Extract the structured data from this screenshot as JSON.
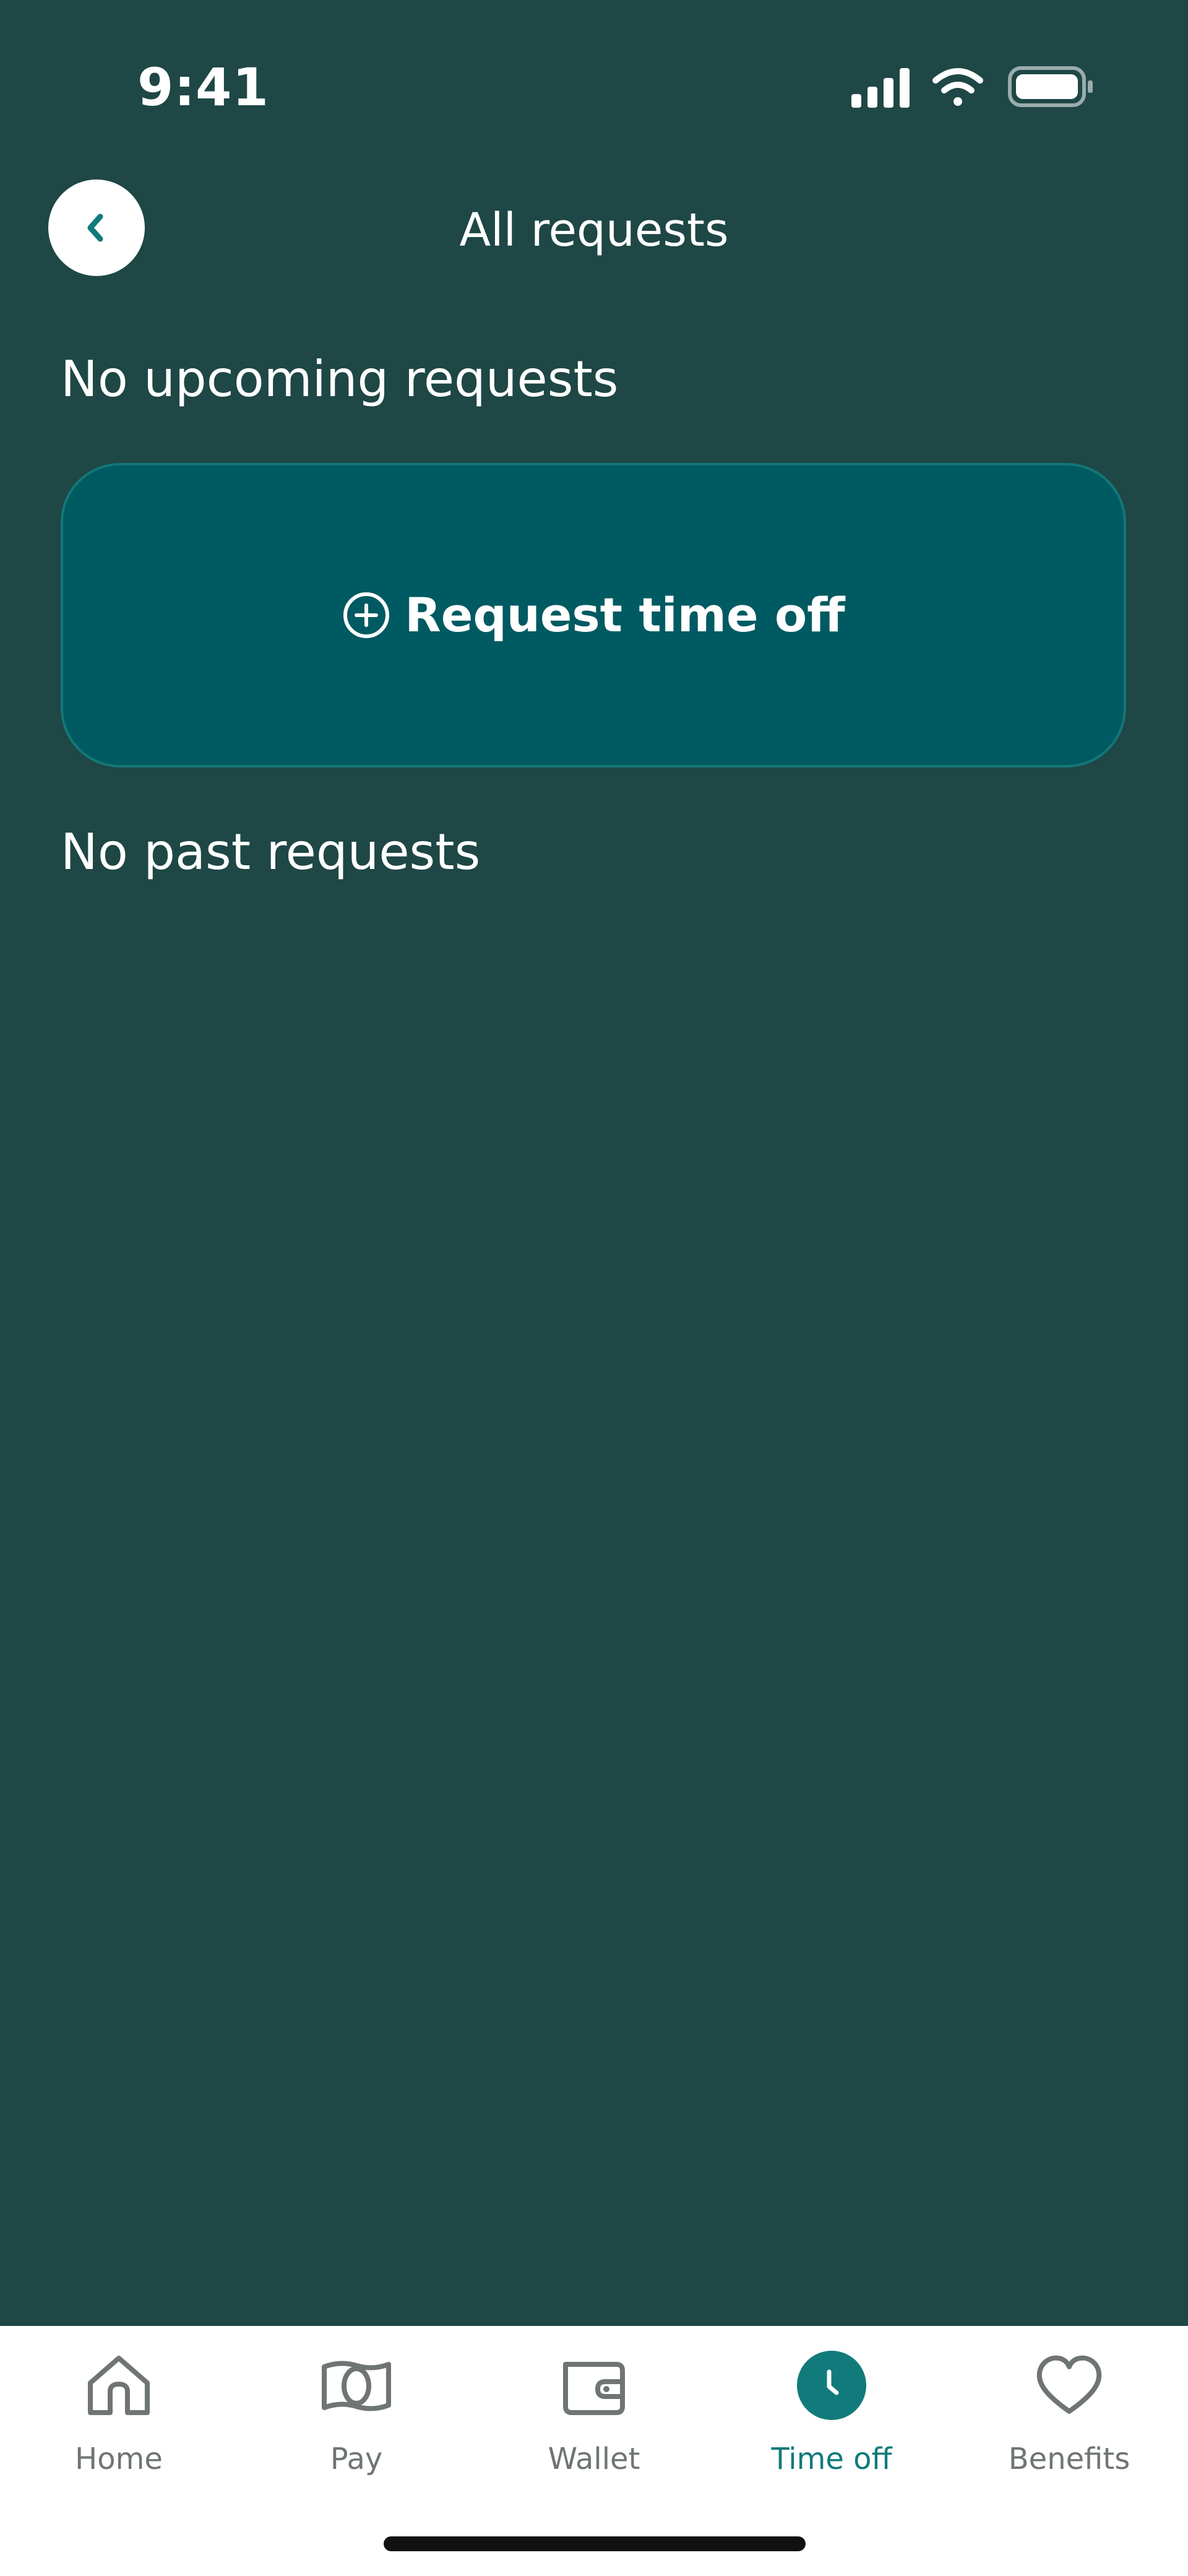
{
  "status_bar": {
    "time": "9:41",
    "icons": [
      "cellular-signal-icon",
      "wifi-icon",
      "battery-icon"
    ]
  },
  "header": {
    "title": "All requests",
    "back_icon": "chevron-left-icon"
  },
  "upcoming": {
    "label": "No upcoming requests",
    "request_button_label": "Request time off",
    "request_icon": "plus-circle-icon"
  },
  "past": {
    "label": "No past requests"
  },
  "tabs": [
    {
      "label": "Home",
      "icon": "home-icon",
      "active": false
    },
    {
      "label": "Pay",
      "icon": "money-icon",
      "active": false
    },
    {
      "label": "Wallet",
      "icon": "wallet-icon",
      "active": false
    },
    {
      "label": "Time off",
      "icon": "clock-icon",
      "active": true
    },
    {
      "label": "Benefits",
      "icon": "heart-icon",
      "active": false
    }
  ],
  "colors": {
    "background": "#1e4746",
    "card": "#005a61",
    "accent": "#117b7b",
    "inactive_tab": "#6f7474"
  }
}
